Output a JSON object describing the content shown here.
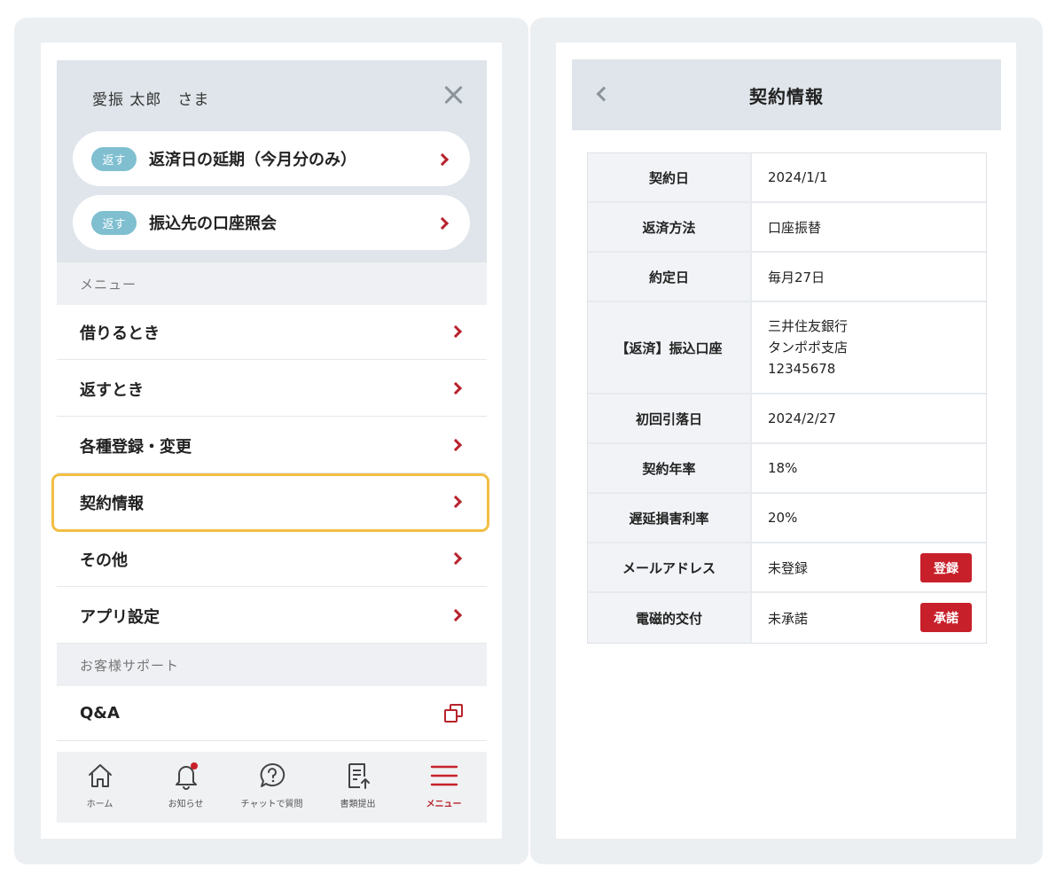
{
  "left": {
    "user_name": "愛振 太郎　さま",
    "quick_actions": [
      {
        "tag": "返す",
        "label": "返済日の延期（今月分のみ）"
      },
      {
        "tag": "返す",
        "label": "振込先の口座照会"
      }
    ],
    "menu_section_label": "メニュー",
    "menu_items": [
      {
        "label": "借りるとき"
      },
      {
        "label": "返すとき"
      },
      {
        "label": "各種登録・変更"
      },
      {
        "label": "契約情報"
      },
      {
        "label": "その他"
      },
      {
        "label": "アプリ設定"
      }
    ],
    "support_section_label": "お客様サポート",
    "support_items": [
      {
        "label": "Q&A",
        "icon": "external-link-icon"
      }
    ],
    "bottom_nav": [
      {
        "label": "ホーム",
        "icon": "home-icon"
      },
      {
        "label": "お知らせ",
        "icon": "bell-icon"
      },
      {
        "label": "チャットで質問",
        "icon": "chat-question-icon"
      },
      {
        "label": "書類提出",
        "icon": "document-upload-icon"
      },
      {
        "label": "メニュー",
        "icon": "hamburger-menu-icon",
        "active": true
      }
    ],
    "highlight_color": "#f2be43",
    "accent_color": "#b8232d"
  },
  "right": {
    "title": "契約情報",
    "rows": [
      {
        "key": "契約日",
        "value": "2024/1/1"
      },
      {
        "key": "返済方法",
        "value": "口座振替"
      },
      {
        "key": "約定日",
        "value": "毎月27日"
      },
      {
        "key": "【返済】振込口座",
        "lines": [
          "三井住友銀行",
          "タンポポ支店",
          "12345678"
        ]
      },
      {
        "key": "初回引落日",
        "value": "2024/2/27"
      },
      {
        "key": "契約年率",
        "value": "18%"
      },
      {
        "key": "遅延損害利率",
        "value": "20%"
      },
      {
        "key": "メールアドレス",
        "value": "未登録",
        "button": "登録"
      },
      {
        "key": "電磁的交付",
        "value": "未承諾",
        "button": "承諾"
      }
    ]
  }
}
